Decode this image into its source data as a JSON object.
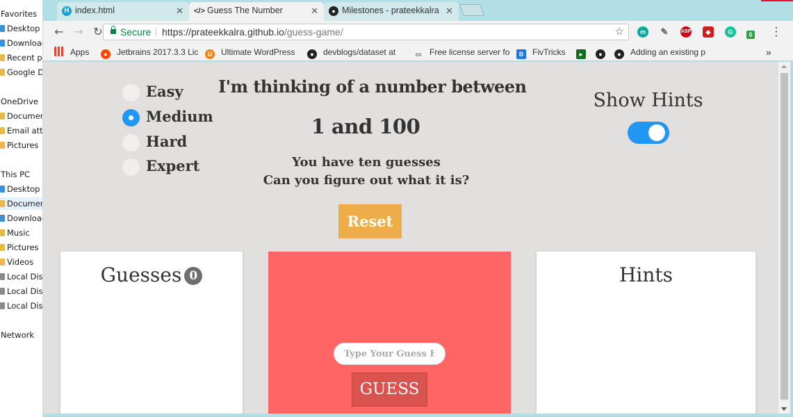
{
  "explorer": {
    "items": [
      {
        "label": "Favorites",
        "kind": "header"
      },
      {
        "label": "Desktop",
        "kind": "folder",
        "color": "#3c8fd6"
      },
      {
        "label": "Downloads",
        "kind": "folder",
        "color": "#3c8fd6"
      },
      {
        "label": "Recent places",
        "kind": "folder",
        "color": "#e8b84a"
      },
      {
        "label": "Google Drive",
        "kind": "folder",
        "color": "#e8b84a"
      },
      {
        "label": "OneDrive",
        "kind": "header"
      },
      {
        "label": "Documents",
        "kind": "folder",
        "color": "#e8b84a"
      },
      {
        "label": "Email attachments",
        "kind": "folder",
        "color": "#e8b84a"
      },
      {
        "label": "Pictures",
        "kind": "folder",
        "color": "#e8b84a"
      },
      {
        "label": "This PC",
        "kind": "header"
      },
      {
        "label": "Desktop",
        "kind": "folder",
        "color": "#3c8fd6"
      },
      {
        "label": "Documents",
        "kind": "folder",
        "color": "#e8b84a",
        "selected": true
      },
      {
        "label": "Downloads",
        "kind": "folder",
        "color": "#3c8fd6"
      },
      {
        "label": "Music",
        "kind": "folder",
        "color": "#e8b84a"
      },
      {
        "label": "Pictures",
        "kind": "folder",
        "color": "#e8b84a"
      },
      {
        "label": "Videos",
        "kind": "folder",
        "color": "#e8b84a"
      },
      {
        "label": "Local Disk",
        "kind": "drive",
        "color": "#8a8a8a"
      },
      {
        "label": "Local Disk",
        "kind": "drive",
        "color": "#8a8a8a"
      },
      {
        "label": "Local Disk",
        "kind": "drive",
        "color": "#8a8a8a"
      },
      {
        "label": "Network",
        "kind": "header"
      }
    ]
  },
  "browser": {
    "tabs": [
      {
        "title": "index.html",
        "icon": "html-file-icon",
        "active": false
      },
      {
        "title": "Guess The Number",
        "icon": "code-icon",
        "active": true
      },
      {
        "title": "Milestones - prateekkalra",
        "icon": "github-icon",
        "active": false
      }
    ],
    "secure_label": "Secure",
    "url_host": "https://prateekkalra.github.io",
    "url_path": "/guess-game/",
    "extensions": [
      {
        "icon": "m-extension-icon",
        "glyph": "m",
        "color": "#00a99d"
      },
      {
        "icon": "eyedropper-icon",
        "glyph": "✎",
        "color": "#666666"
      },
      {
        "icon": "adblock-icon",
        "glyph": "ABP",
        "color": "#d0021b"
      },
      {
        "icon": "ruby-icon",
        "glyph": "◆",
        "color": "#cc1f1f"
      },
      {
        "icon": "grammarly-icon",
        "glyph": "G",
        "color": "#15c39a"
      },
      {
        "icon": "badge-extension-icon",
        "glyph": "0",
        "color": "#2ea043"
      }
    ],
    "bookmarks": [
      {
        "label": "Apps",
        "icon": "apps-grid-icon"
      },
      {
        "label": "Jetbrains 2017.3.3 Lic",
        "icon": "reddit-icon"
      },
      {
        "label": "Ultimate WordPress",
        "icon": "wordpress-plugin-icon"
      },
      {
        "label": "devblogs/dataset at",
        "icon": "github-icon"
      },
      {
        "label": "Free license server fo",
        "icon": "document-icon"
      },
      {
        "label": "FivTricks",
        "icon": "fivtricks-icon"
      },
      {
        "label": "",
        "icon": "terminal-icon"
      },
      {
        "label": "",
        "icon": "github-icon"
      },
      {
        "label": "Adding an existing p",
        "icon": "github-icon"
      }
    ],
    "overflow_label": "»"
  },
  "game": {
    "difficulties": [
      {
        "label": "Easy",
        "checked": false
      },
      {
        "label": "Medium",
        "checked": true
      },
      {
        "label": "Hard",
        "checked": false
      },
      {
        "label": "Expert",
        "checked": false
      }
    ],
    "headline": "I'm thinking of a number between",
    "range_text": "1 and 100",
    "guess_count_text": "You have ten guesses",
    "tagline": "Can you figure out what it is?",
    "reset_label": "Reset",
    "hints_toggle_label": "Show Hints",
    "hints_enabled": true,
    "guesses_title": "Guesses",
    "guesses_count": "0",
    "hints_title": "Hints",
    "guess_placeholder": "Type Your Guess Here",
    "guess_value": "",
    "guess_button_label": "GUESS"
  },
  "colors": {
    "accent_blue": "#2196f3",
    "reset_orange": "#efad4a",
    "game_card_red": "#ff6565",
    "guess_button_red": "#d9534f",
    "page_background": "#e2e0df",
    "chrome_frame": "#b2dfe6"
  }
}
